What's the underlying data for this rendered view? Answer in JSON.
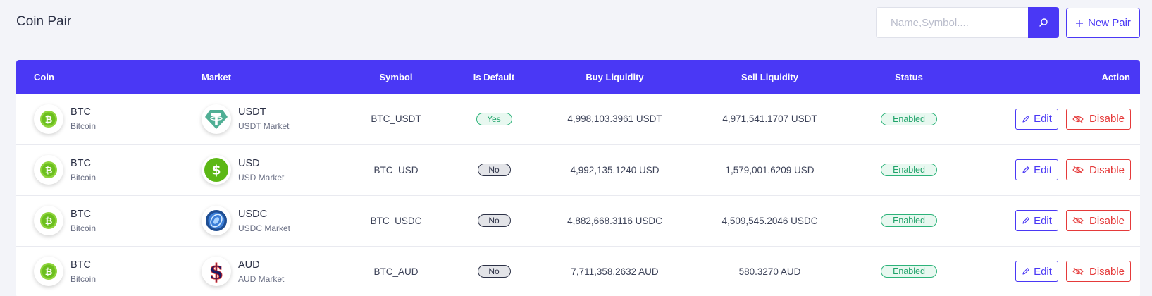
{
  "header": {
    "title": "Coin Pair",
    "search_placeholder": "Name,Symbol....",
    "search_value": "",
    "new_pair_label": "New Pair"
  },
  "colors": {
    "accent": "#4a38f5",
    "success": "#21a36a",
    "danger": "#e53a3a"
  },
  "table": {
    "columns": [
      "Coin",
      "Market",
      "Symbol",
      "Is Default",
      "Buy Liquidity",
      "Sell Liquidity",
      "Status",
      "Action"
    ],
    "rows": [
      {
        "coin_symbol": "BTC",
        "coin_name": "Bitcoin",
        "coin_icon": "bitcoin-icon",
        "market_symbol": "USDT",
        "market_name": "USDT Market",
        "market_icon": "tether-icon",
        "pair_symbol": "BTC_USDT",
        "is_default": "Yes",
        "buy_liquidity": "4,998,103.3961 USDT",
        "sell_liquidity": "4,971,541.1707 USDT",
        "status": "Enabled",
        "edit_label": "Edit",
        "disable_label": "Disable"
      },
      {
        "coin_symbol": "BTC",
        "coin_name": "Bitcoin",
        "coin_icon": "bitcoin-icon",
        "market_symbol": "USD",
        "market_name": "USD Market",
        "market_icon": "dollar-icon",
        "pair_symbol": "BTC_USD",
        "is_default": "No",
        "buy_liquidity": "4,992,135.1240 USD",
        "sell_liquidity": "1,579,001.6209 USD",
        "status": "Enabled",
        "edit_label": "Edit",
        "disable_label": "Disable"
      },
      {
        "coin_symbol": "BTC",
        "coin_name": "Bitcoin",
        "coin_icon": "bitcoin-icon",
        "market_symbol": "USDC",
        "market_name": "USDC Market",
        "market_icon": "usdc-icon",
        "pair_symbol": "BTC_USDC",
        "is_default": "No",
        "buy_liquidity": "4,882,668.3116 USDC",
        "sell_liquidity": "4,509,545.2046 USDC",
        "status": "Enabled",
        "edit_label": "Edit",
        "disable_label": "Disable"
      },
      {
        "coin_symbol": "BTC",
        "coin_name": "Bitcoin",
        "coin_icon": "bitcoin-icon",
        "market_symbol": "AUD",
        "market_name": "AUD Market",
        "market_icon": "aud-dollar-icon",
        "pair_symbol": "BTC_AUD",
        "is_default": "No",
        "buy_liquidity": "7,711,358.2632 AUD",
        "sell_liquidity": "580.3270 AUD",
        "status": "Enabled",
        "edit_label": "Edit",
        "disable_label": "Disable"
      }
    ]
  }
}
